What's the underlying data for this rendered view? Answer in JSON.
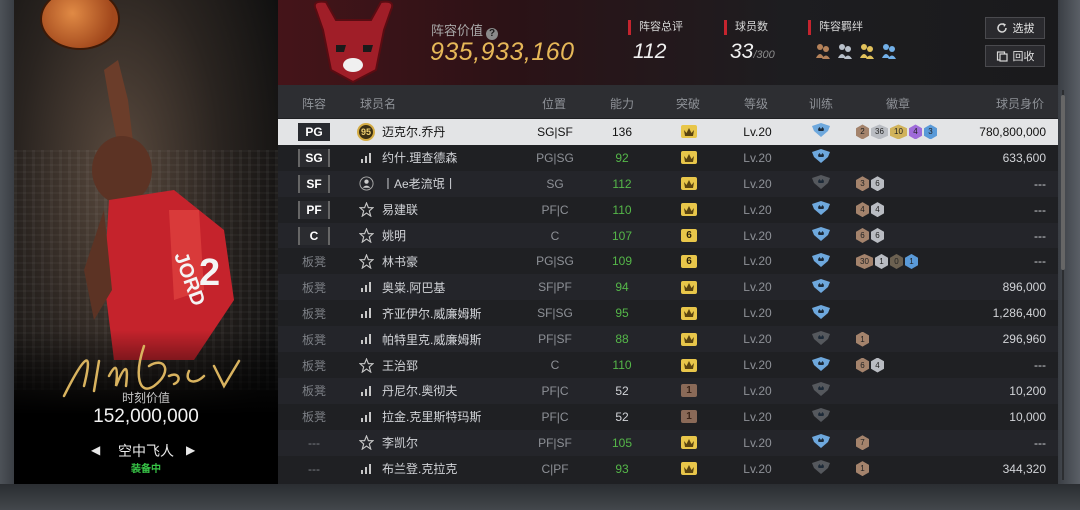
{
  "card": {
    "value_label": "时刻价值",
    "value_amount": "152,000,000",
    "skin_name": "空中飞人",
    "skin_status": "装备中",
    "signature": "I'm Back",
    "prev": "◀",
    "next": "▶"
  },
  "header": {
    "team_logo_text": "CHICAGO BULLS",
    "value_title": "阵容价值",
    "help": "?",
    "value_total": "935,933,160",
    "rating_title": "阵容总评",
    "rating_value": "112",
    "count_title": "球员数",
    "count_value": "33",
    "count_max": "/300",
    "bonds_title": "阵容羁绊",
    "bond_icons": [
      "bond-icon-bronze",
      "bond-icon-silver",
      "bond-icon-gold",
      "bond-icon-blue"
    ],
    "select_label": "选拔",
    "recycle_label": "回收"
  },
  "table": {
    "headers": {
      "lineup": "阵容",
      "name": "球员名",
      "position": "位置",
      "ability": "能力",
      "breakthrough": "突破",
      "level": "等级",
      "training": "训练",
      "badges": "徽章",
      "value": "球员身价"
    },
    "rows": [
      {
        "slot": "PG",
        "icon": "95",
        "name": "迈克尔.乔丹",
        "pos": "SG|SF",
        "ability": "136",
        "green": false,
        "brk": "crown",
        "level": "Lv.20",
        "train": "blue",
        "badges": [
          [
            "bronze",
            "2"
          ],
          [
            "silver",
            "36"
          ],
          [
            "gold",
            "10"
          ],
          [
            "purple",
            "4"
          ],
          [
            "blue",
            "3"
          ]
        ],
        "price": "780,800,000",
        "selected": true
      },
      {
        "slot": "SG",
        "icon": "bars",
        "name": "约什.理查德森",
        "pos": "PG|SG",
        "ability": "92",
        "green": true,
        "brk": "crown",
        "level": "Lv.20",
        "train": "blue",
        "badges": [],
        "price": "633,600"
      },
      {
        "slot": "SF",
        "icon": "person",
        "name": "丨Ae老流氓丨",
        "pos": "SG",
        "ability": "112",
        "green": true,
        "brk": "crown",
        "level": "Lv.20",
        "train": "gray",
        "badges": [
          [
            "bronze",
            "3"
          ],
          [
            "silver",
            "6"
          ]
        ],
        "price": "---"
      },
      {
        "slot": "PF",
        "icon": "star",
        "name": "易建联",
        "pos": "PF|C",
        "ability": "110",
        "green": true,
        "brk": "crown",
        "level": "Lv.20",
        "train": "blue",
        "badges": [
          [
            "bronze",
            "4"
          ],
          [
            "silver",
            "4"
          ]
        ],
        "price": "---"
      },
      {
        "slot": "C",
        "icon": "star",
        "name": "姚明",
        "pos": "C",
        "ability": "107",
        "green": true,
        "brk": "6",
        "level": "Lv.20",
        "train": "blue",
        "badges": [
          [
            "bronze",
            "6"
          ],
          [
            "silver",
            "6"
          ]
        ],
        "price": "---"
      },
      {
        "slot": "板凳",
        "icon": "star",
        "name": "林书豪",
        "pos": "PG|SG",
        "ability": "109",
        "green": true,
        "brk": "6",
        "level": "Lv.20",
        "train": "blue",
        "badges": [
          [
            "bronze",
            "30"
          ],
          [
            "silver",
            "1"
          ],
          [
            "dark",
            "0"
          ],
          [
            "blue",
            "1"
          ]
        ],
        "price": "---"
      },
      {
        "slot": "板凳",
        "icon": "bars",
        "name": "奥粜.阿巴基",
        "pos": "SF|PF",
        "ability": "94",
        "green": true,
        "brk": "crown",
        "level": "Lv.20",
        "train": "blue",
        "badges": [],
        "price": "896,000"
      },
      {
        "slot": "板凳",
        "icon": "bars",
        "name": "齐亚伊尔.威廉姆斯",
        "pos": "SF|SG",
        "ability": "95",
        "green": true,
        "brk": "crown",
        "level": "Lv.20",
        "train": "blue",
        "badges": [],
        "price": "1,286,400"
      },
      {
        "slot": "板凳",
        "icon": "bars",
        "name": "帕特里克.威廉姆斯",
        "pos": "PF|SF",
        "ability": "88",
        "green": true,
        "brk": "crown",
        "level": "Lv.20",
        "train": "gray",
        "badges": [
          [
            "bronze",
            "1"
          ]
        ],
        "price": "296,960"
      },
      {
        "slot": "板凳",
        "icon": "star",
        "name": "王治郅",
        "pos": "C",
        "ability": "110",
        "green": true,
        "brk": "crown",
        "level": "Lv.20",
        "train": "blue",
        "badges": [
          [
            "bronze",
            "6"
          ],
          [
            "silver",
            "4"
          ]
        ],
        "price": "---"
      },
      {
        "slot": "板凳",
        "icon": "bars",
        "name": "丹尼尔.奥彻夫",
        "pos": "PF|C",
        "ability": "52",
        "green": false,
        "brk": "1",
        "level": "Lv.20",
        "train": "gray",
        "badges": [],
        "price": "10,200"
      },
      {
        "slot": "板凳",
        "icon": "bars",
        "name": "拉金.克里斯特玛斯",
        "pos": "PF|C",
        "ability": "52",
        "green": false,
        "brk": "1",
        "level": "Lv.20",
        "train": "gray",
        "badges": [],
        "price": "10,000"
      },
      {
        "slot": "---",
        "icon": "star",
        "name": "李凯尔",
        "pos": "PF|SF",
        "ability": "105",
        "green": true,
        "brk": "crown",
        "level": "Lv.20",
        "train": "blue",
        "badges": [
          [
            "bronze",
            "7"
          ]
        ],
        "price": "---"
      },
      {
        "slot": "---",
        "icon": "bars",
        "name": "布兰登.克拉克",
        "pos": "C|PF",
        "ability": "93",
        "green": true,
        "brk": "crown",
        "level": "Lv.20",
        "train": "gray",
        "badges": [
          [
            "bronze",
            "1"
          ]
        ],
        "price": "344,320"
      }
    ]
  }
}
